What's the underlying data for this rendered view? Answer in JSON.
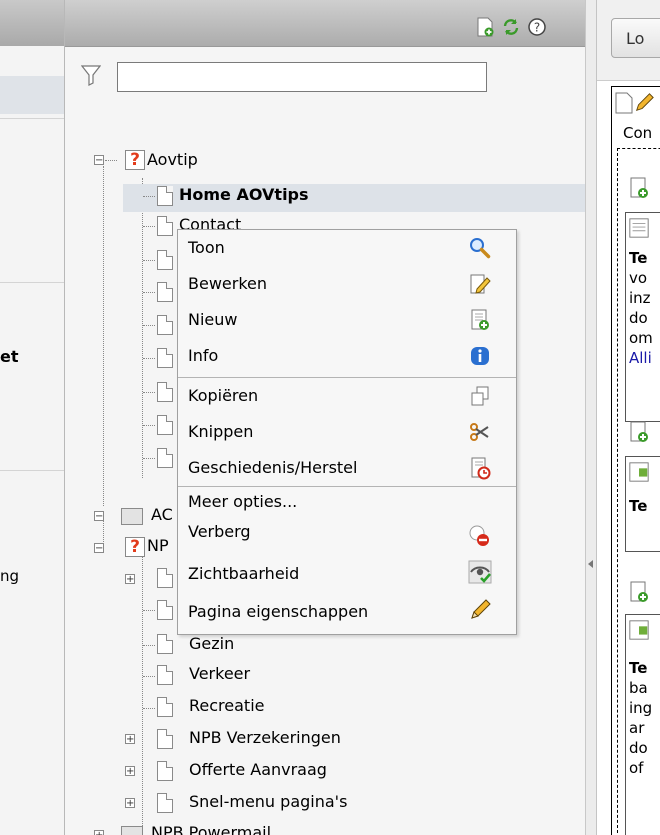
{
  "left_module_menu": {
    "item_et": "et",
    "item_ng": "ng"
  },
  "tree": {
    "filter_placeholder": "",
    "nodes": {
      "root1": "Aovtip",
      "home": "Home AOVtips",
      "contact": "Contact",
      "root2_partial": "AC",
      "root3_partial": "NP",
      "gezin": "Gezin",
      "verkeer": "Verkeer",
      "recreatie": "Recreatie",
      "npb_verzekeringen": "NPB Verzekeringen",
      "offerte": "Offerte Aanvraag",
      "snelmenu": "Snel-menu pagina's",
      "powermail": "NPB Powermail"
    }
  },
  "context_menu": {
    "toon": "Toon",
    "bewerken": "Bewerken",
    "nieuw": "Nieuw",
    "info": "Info",
    "kopieren": "Kopiëren",
    "knippen": "Knippen",
    "geschiedenis": "Geschiedenis/Herstel",
    "meer_opties": "Meer opties...",
    "verberg": "Verberg",
    "zichtbaarheid": "Zichtbaarheid",
    "pagina_eigenschappen": "Pagina eigenschappen"
  },
  "content": {
    "lo_button": "Lo",
    "col_label": "Con",
    "block1": [
      "Te",
      "vo",
      "inz",
      "do",
      "om"
    ],
    "block1_link": "Alli",
    "block2_title": "Te",
    "block3": [
      "Te",
      "ba",
      "ing",
      "ar",
      "do",
      "of"
    ]
  },
  "colors": {
    "selected_row": "#dde2e8",
    "accent_blue": "#2a6fd0",
    "link": "#1a1aa8"
  }
}
